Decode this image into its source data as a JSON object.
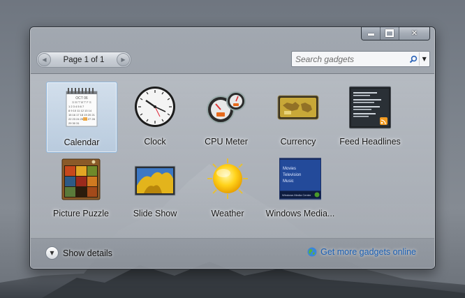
{
  "window": {
    "caption_buttons": [
      {
        "name": "minimize-icon"
      },
      {
        "name": "maximize-icon"
      },
      {
        "name": "close-icon",
        "glyph": "✕"
      }
    ]
  },
  "pager": {
    "text": "Page 1 of 1",
    "prev_icon": "arrow-left-icon",
    "next_icon": "arrow-right-icon"
  },
  "search": {
    "placeholder": "Search gadgets",
    "icon": "search-icon",
    "dropdown_icon": "chevron-down-icon"
  },
  "gadgets": [
    {
      "label": "Calendar",
      "icon": "calendar-icon",
      "selected": true,
      "calendar_month": "OCT 06",
      "calendar_days": "S M T W T F S",
      "highlight_day": "25"
    },
    {
      "label": "Clock",
      "icon": "clock-icon"
    },
    {
      "label": "CPU Meter",
      "icon": "cpu-meter-icon"
    },
    {
      "label": "Currency",
      "icon": "currency-icon"
    },
    {
      "label": "Feed Headlines",
      "icon": "feed-icon"
    },
    {
      "label": "Picture Puzzle",
      "icon": "puzzle-icon"
    },
    {
      "label": "Slide Show",
      "icon": "slideshow-icon"
    },
    {
      "label": "Weather",
      "icon": "weather-sun-icon"
    },
    {
      "label": "Windows Media...",
      "icon": "windows-media-center-icon",
      "tile_lines": [
        "Movies",
        "Television",
        "Music"
      ],
      "tile_footer": "Windows Media Center"
    }
  ],
  "footer": {
    "details_label": "Show details",
    "details_icon": "chevron-down-icon",
    "online_label": "Get more gadgets online",
    "online_icon": "globe-icon"
  },
  "colors": {
    "link": "#1a5fb4",
    "selection": "#8fb6dc"
  }
}
